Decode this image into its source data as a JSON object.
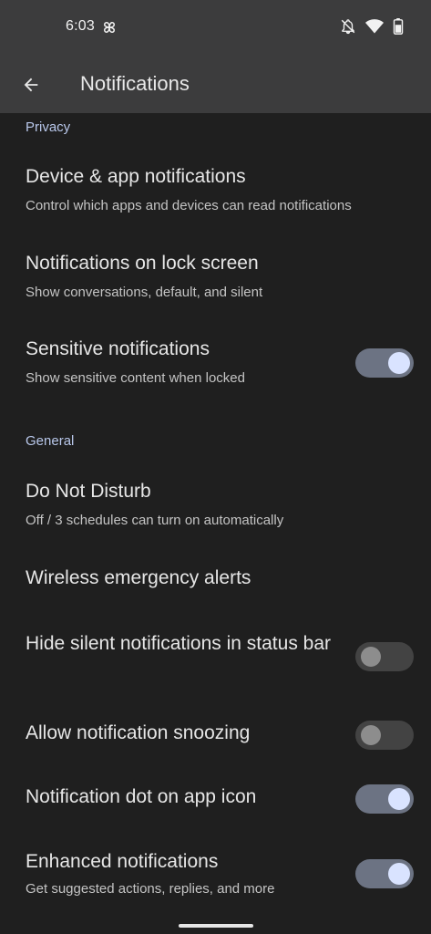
{
  "status_bar": {
    "time": "6:03"
  },
  "app_bar": {
    "title": "Notifications"
  },
  "sections": {
    "privacy": {
      "header": "Privacy",
      "items": [
        {
          "title": "Device & app notifications",
          "subtitle": "Control which apps and devices can read notifications"
        },
        {
          "title": "Notifications on lock screen",
          "subtitle": "Show conversations, default, and silent"
        },
        {
          "title": "Sensitive notifications",
          "subtitle": "Show sensitive content when locked",
          "toggle": "on"
        }
      ]
    },
    "general": {
      "header": "General",
      "items": [
        {
          "title": "Do Not Disturb",
          "subtitle": "Off / 3 schedules can turn on automatically"
        },
        {
          "title": "Wireless emergency alerts"
        },
        {
          "title": "Hide silent notifications in status bar",
          "toggle": "off"
        },
        {
          "title": "Allow notification snoozing",
          "toggle": "off"
        },
        {
          "title": "Notification dot on app icon",
          "toggle": "on"
        },
        {
          "title": "Enhanced notifications",
          "subtitle": "Get suggested actions, replies, and more",
          "toggle": "on"
        }
      ]
    }
  },
  "colors": {
    "bar_background": "#3c3c3d",
    "page_background": "#1f1f1f",
    "section_header": "#b8c7ea",
    "toggle_on_track": "#6c7383",
    "toggle_on_thumb": "#d9e3ff",
    "toggle_off_track": "#434343",
    "toggle_off_thumb": "#8d8d8d"
  },
  "icons": {
    "status_left": "fan-icon",
    "status_right": [
      "notifications-off-icon",
      "wifi-icon",
      "battery-icon"
    ],
    "app_bar": "back-arrow-icon"
  }
}
